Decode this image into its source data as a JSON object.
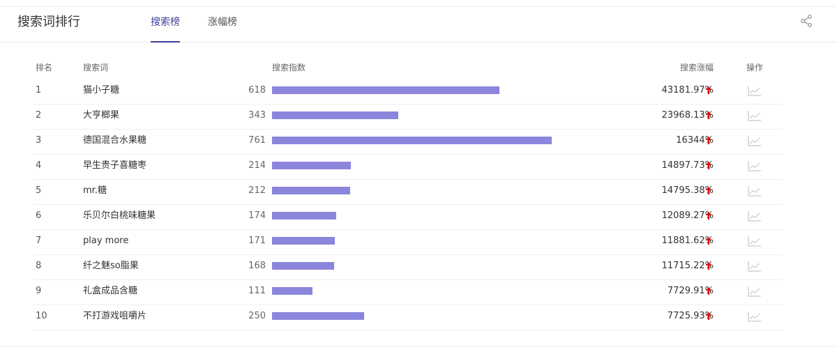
{
  "header": {
    "title": "搜索词排行",
    "tabs": [
      {
        "label": "搜索榜",
        "active": true
      },
      {
        "label": "涨幅榜",
        "active": false
      }
    ],
    "share_icon": "share-icon"
  },
  "table": {
    "columns": {
      "rank": "排名",
      "keyword": "搜索词",
      "index": "搜索指数",
      "growth": "搜索涨幅",
      "action": "操作"
    },
    "max_index": 761,
    "rows": [
      {
        "rank": "1",
        "keyword": "猫小子糖",
        "index": 618,
        "growth": "43181.97%"
      },
      {
        "rank": "2",
        "keyword": "大亨榔果",
        "index": 343,
        "growth": "23968.13%"
      },
      {
        "rank": "3",
        "keyword": "德国混合水果糖",
        "index": 761,
        "growth": "16344%"
      },
      {
        "rank": "4",
        "keyword": "早生贵子喜糖枣",
        "index": 214,
        "growth": "14897.73%"
      },
      {
        "rank": "5",
        "keyword": "mr.糖",
        "index": 212,
        "growth": "14795.38%"
      },
      {
        "rank": "6",
        "keyword": "乐贝尔白桃味糖果",
        "index": 174,
        "growth": "12089.27%"
      },
      {
        "rank": "7",
        "keyword": "play more",
        "index": 171,
        "growth": "11881.62%"
      },
      {
        "rank": "8",
        "keyword": "纤之魅so脂果",
        "index": 168,
        "growth": "11715.22%"
      },
      {
        "rank": "9",
        "keyword": "礼盒成品含糖",
        "index": 111,
        "growth": "7729.91%"
      },
      {
        "rank": "10",
        "keyword": "不打游戏咀嚼片",
        "index": 250,
        "growth": "7725.93%"
      }
    ]
  },
  "colors": {
    "accent": "#3f3f9a",
    "bar": "#8b86dc",
    "up_arrow": "#e60000"
  }
}
